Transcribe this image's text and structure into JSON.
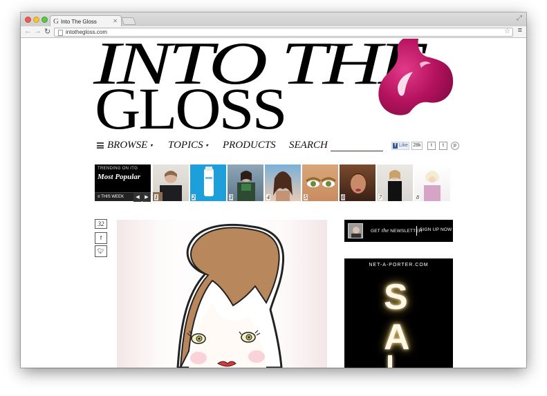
{
  "browser": {
    "tab_title": "Into The Gloss",
    "tab_favicon": "G",
    "url": "intothegloss.com"
  },
  "site": {
    "logo_line1": "INTO THE",
    "logo_line2": "GLOSS",
    "accent_color": "#c5176b"
  },
  "nav": {
    "browse": "BROWSE",
    "topics": "TOPICS",
    "products": "PRODUCTS",
    "search": "SEARCH",
    "fb_like": "Like",
    "fb_count": "28k",
    "twitter": "t",
    "tumblr": "t",
    "pinterest": "p"
  },
  "trending": {
    "label": "TRENDING ON ITG",
    "title": "Most Popular",
    "period": "THIS WEEK",
    "thumbnails": [
      {
        "num": "1"
      },
      {
        "num": "2"
      },
      {
        "num": "3"
      },
      {
        "num": "4"
      },
      {
        "num": "5"
      },
      {
        "num": "6"
      },
      {
        "num": "7"
      },
      {
        "num": "8"
      }
    ]
  },
  "article": {
    "comment_count": "32",
    "share_facebook": "f",
    "share_twitter": "t"
  },
  "newsletter": {
    "text_get": "GET",
    "text_the": "the",
    "text_newsletter": "NEWSLETTER",
    "signup": "SIGN UP NOW"
  },
  "ad": {
    "brand": "NET-A-PORTER.COM",
    "letter1": "S",
    "letter2": "A"
  }
}
